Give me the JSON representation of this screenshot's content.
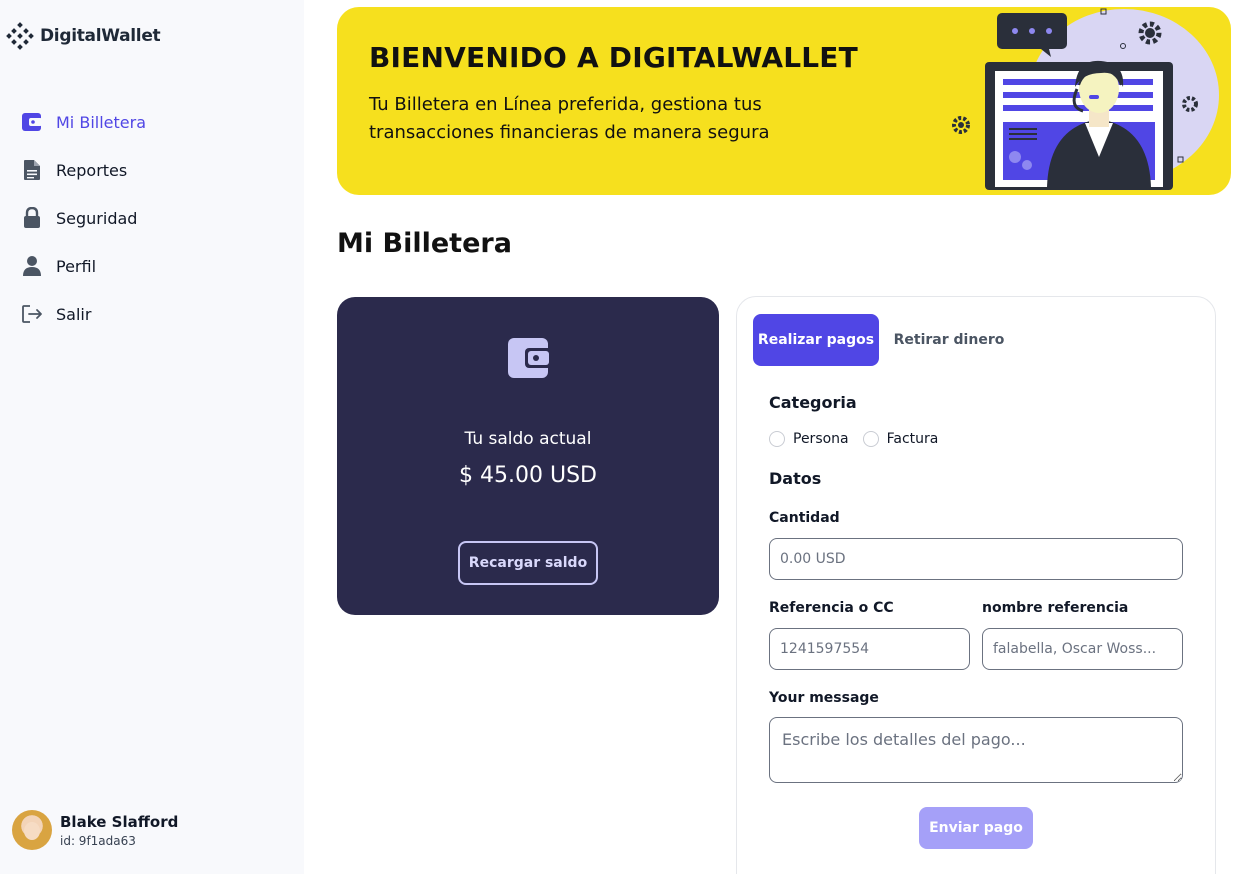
{
  "app": {
    "name": "DigitalWallet"
  },
  "sidebar": {
    "items": [
      {
        "label": "Mi Billetera",
        "icon": "wallet-icon",
        "active": true
      },
      {
        "label": "Reportes",
        "icon": "document-icon"
      },
      {
        "label": "Seguridad",
        "icon": "lock-icon"
      },
      {
        "label": "Perfil",
        "icon": "user-icon"
      },
      {
        "label": "Salir",
        "icon": "logout-icon"
      }
    ],
    "user": {
      "name": "Blake Slafford",
      "id": "id: 9f1ada63"
    }
  },
  "banner": {
    "title": "BIENVENIDO A DIGITALWALLET",
    "subtitle": "Tu Billetera en Línea preferida, gestiona tus transacciones financieras de manera segura",
    "accent": "#f6e01e"
  },
  "page": {
    "title": "Mi Billetera"
  },
  "balance": {
    "label": "Tu saldo actual",
    "value": "$ 45.00 USD",
    "recharge_label": "Recargar saldo"
  },
  "form": {
    "tabs": [
      {
        "label": "Realizar pagos",
        "active": true
      },
      {
        "label": "Retirar dinero"
      }
    ],
    "category_title": "Categoria",
    "categories": [
      "Persona",
      "Factura"
    ],
    "data_title": "Datos",
    "amount_label": "Cantidad",
    "amount_placeholder": "0.00 USD",
    "reference_label": "Referencia o CC",
    "reference_placeholder": "1241597554",
    "reference_name_label": "nombre referencia",
    "reference_name_placeholder": "falabella, Oscar Woss...",
    "message_label": "Your message",
    "message_placeholder": "Escribe los detalles del pago...",
    "submit_label": "Enviar pago"
  },
  "colors": {
    "primary": "#5046e5",
    "card_dark": "#2b2a4c",
    "submit_disabled": "#a5a0f8"
  }
}
